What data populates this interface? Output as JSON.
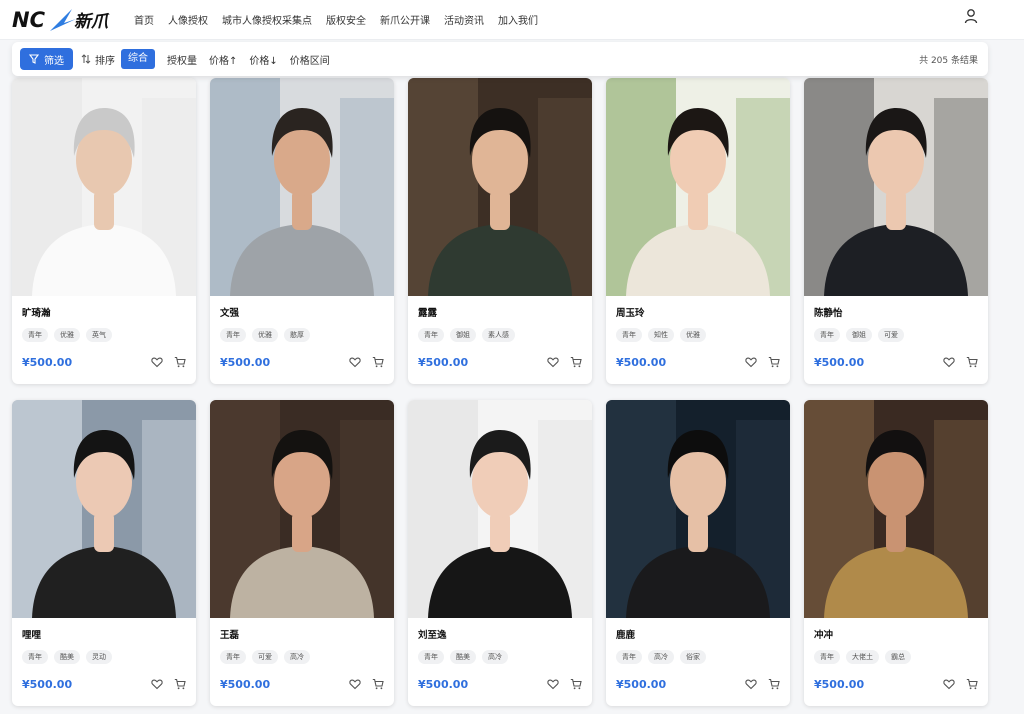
{
  "brand": {
    "logo_text": "NC",
    "logo_cn": "新爪"
  },
  "nav": [
    "首页",
    "人像授权",
    "城市人像授权采集点",
    "版权安全",
    "新爪公开课",
    "活动资讯",
    "加入我们"
  ],
  "filter": {
    "filter_label": "筛选",
    "sort_label": "排序",
    "options": [
      "综合",
      "授权量",
      "价格↑",
      "价格↓",
      "价格区间"
    ],
    "active": "综合",
    "result_count": "共 205 条结果"
  },
  "cards": [
    {
      "name": "旷琦瀚",
      "tags": [
        "青年",
        "优雅",
        "英气"
      ],
      "price": "¥500.00",
      "photo": {
        "bg": "#f2f2f2",
        "bg2": "#e6e6e6",
        "hair": "#c9c9c9",
        "cloth": "#fafafa",
        "skin": "#e8c8b0"
      }
    },
    {
      "name": "文强",
      "tags": [
        "青年",
        "优雅",
        "憨厚"
      ],
      "price": "¥500.00",
      "photo": {
        "bg": "#d8dbde",
        "bg2": "#8da0b4",
        "hair": "#2a2420",
        "cloth": "#9ea3a8",
        "skin": "#d9a98a"
      }
    },
    {
      "name": "露露",
      "tags": [
        "青年",
        "御姐",
        "素人感"
      ],
      "price": "¥500.00",
      "photo": {
        "bg": "#3d2f25",
        "bg2": "#6a5643",
        "hair": "#151210",
        "cloth": "#2f3a31",
        "skin": "#e0b596"
      }
    },
    {
      "name": "周玉玲",
      "tags": [
        "青年",
        "知性",
        "优雅"
      ],
      "price": "¥500.00",
      "photo": {
        "bg": "#eef0e6",
        "bg2": "#7ea35a",
        "hair": "#1c1714",
        "cloth": "#ece6da",
        "skin": "#f0ccb4"
      }
    },
    {
      "name": "陈静怡",
      "tags": [
        "青年",
        "御姐",
        "可爱"
      ],
      "price": "¥500.00",
      "photo": {
        "bg": "#d8d6d2",
        "bg2": "#4a4a48",
        "hair": "#1a1716",
        "cloth": "#1d1f24",
        "skin": "#ecc8b0"
      }
    },
    {
      "name": "哩哩",
      "tags": [
        "青年",
        "酷美",
        "灵动"
      ],
      "price": "¥500.00",
      "photo": {
        "bg": "#8b99a8",
        "bg2": "#e6ebf0",
        "hair": "#141414",
        "cloth": "#202020",
        "skin": "#ecc9b4"
      }
    },
    {
      "name": "王磊",
      "tags": [
        "青年",
        "可爱",
        "高冷"
      ],
      "price": "¥500.00",
      "photo": {
        "bg": "#3a2c24",
        "bg2": "#5a4536",
        "hair": "#141210",
        "cloth": "#bdb2a2",
        "skin": "#d8a587"
      }
    },
    {
      "name": "刘至逸",
      "tags": [
        "青年",
        "酷美",
        "高冷"
      ],
      "price": "¥500.00",
      "photo": {
        "bg": "#f4f4f4",
        "bg2": "#dedede",
        "hair": "#1b1b1b",
        "cloth": "#161616",
        "skin": "#f0cdb8"
      }
    },
    {
      "name": "鹿鹿",
      "tags": [
        "青年",
        "高冷",
        "俗家"
      ],
      "price": "¥500.00",
      "photo": {
        "bg": "#14202c",
        "bg2": "#2d4050",
        "hair": "#0d0d0d",
        "cloth": "#1a1a1c",
        "skin": "#e6c0a6"
      }
    },
    {
      "name": "冲冲",
      "tags": [
        "青年",
        "大佬土",
        "霸总"
      ],
      "price": "¥500.00",
      "photo": {
        "bg": "#3a2a22",
        "bg2": "#8a6a48",
        "hair": "#121010",
        "cloth": "#b08a4a",
        "skin": "#c99372"
      }
    }
  ]
}
